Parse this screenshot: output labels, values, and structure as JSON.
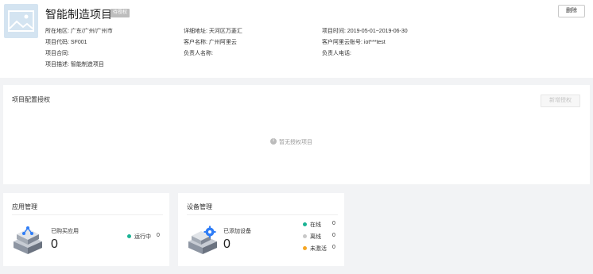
{
  "project": {
    "title": "智能制造项目",
    "status_badge": "待授权",
    "delete_label": "删除"
  },
  "info": {
    "region_label": "所在地区:",
    "region_value": "广东/广州/广州市",
    "address_label": "详细地址:",
    "address_value": "天河区万菱汇",
    "time_label": "项目时间:",
    "time_value": "2019-05-01~2019-06-30",
    "code_label": "项目代码:",
    "code_value": "SF001",
    "customer_label": "客户名称:",
    "customer_value": "广州阿里云",
    "account_label": "客户阿里云账号:",
    "account_value": "iot***test",
    "contract_label": "项目合同:",
    "contract_value": "",
    "owner_label": "负责人名称:",
    "owner_value": "",
    "phone_label": "负责人电话:",
    "phone_value": "",
    "desc_label": "项目描述:",
    "desc_value": "智能制造项目"
  },
  "config": {
    "title": "项目配置授权",
    "add_label": "新增授权",
    "empty_text": "暂无授权项目"
  },
  "apps": {
    "title": "应用管理",
    "purchased_label": "已购买应用",
    "purchased_count": "0",
    "running_label": "运行中",
    "running_count": "0",
    "running_color": "#1ab394"
  },
  "devices": {
    "title": "设备管理",
    "added_label": "已添加设备",
    "added_count": "0",
    "statuses": [
      {
        "label": "在线",
        "count": "0",
        "color": "#1ab394"
      },
      {
        "label": "离线",
        "count": "0",
        "color": "#c8c8c8"
      },
      {
        "label": "未激活",
        "count": "0",
        "color": "#f5a623"
      }
    ]
  },
  "icons": {
    "project_image": "image-placeholder-icon",
    "empty": "info-circle-icon",
    "apps": "app-cube-icon",
    "devices": "device-gear-cube-icon"
  }
}
